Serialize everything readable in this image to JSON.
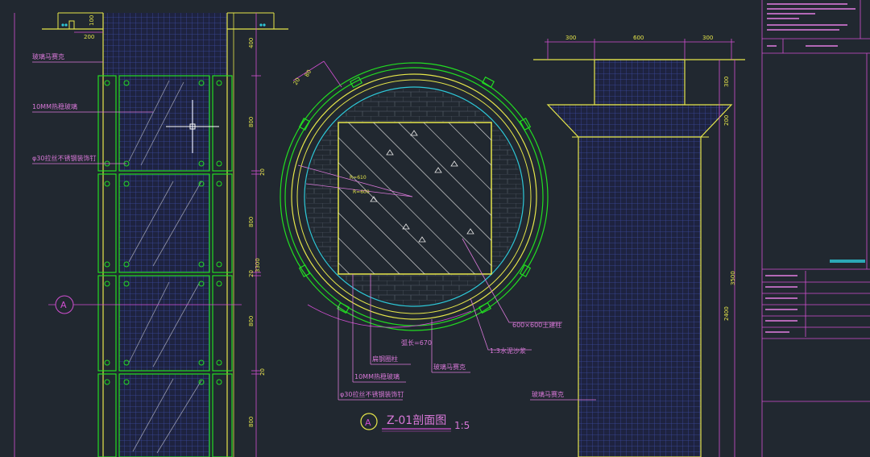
{
  "colors": {
    "background": "#212830",
    "green": "#22dd22",
    "yellow": "#e6e64a",
    "magenta": "#d24fd2",
    "cyan": "#2ec8d8",
    "white": "#e8e8e8",
    "hatch_blue": "#3a4a9a",
    "text_pink": "#d878d8"
  },
  "left_elevation": {
    "labels": {
      "mosaic": "玻璃马赛克",
      "glass": "10MM热稳玻璃",
      "nail": "φ30拉丝不锈钢装饰钉"
    },
    "dims": {
      "top_width": "200",
      "top_height": "100",
      "top_side": "400",
      "d1": "800",
      "d2": "20",
      "d3": "800",
      "d4": "20",
      "total": "3300",
      "d5": "800",
      "d6": "20",
      "d7": "800"
    },
    "section_marker": "A"
  },
  "section": {
    "dims": {
      "a": "20",
      "b": "80",
      "r1": "R=610",
      "r2": "R=600",
      "arc": "弧长=670"
    },
    "labels": {
      "column": "600×600土建柱",
      "mortar": "1:3水泥沙浆",
      "steel": "扁钢圈柱",
      "glass": "10MM热稳玻璃",
      "mosaic": "玻璃马赛克",
      "nail": "φ30拉丝不锈钢装饰钉"
    },
    "title_marker": "A",
    "title": "Z-01剖面图",
    "scale": "1:5"
  },
  "right_elevation": {
    "dims": {
      "w1": "300",
      "w2": "600",
      "w3": "300",
      "h1": "300",
      "h2": "200",
      "total": "3500",
      "h3": "2400"
    },
    "label": "玻璃马赛克"
  }
}
